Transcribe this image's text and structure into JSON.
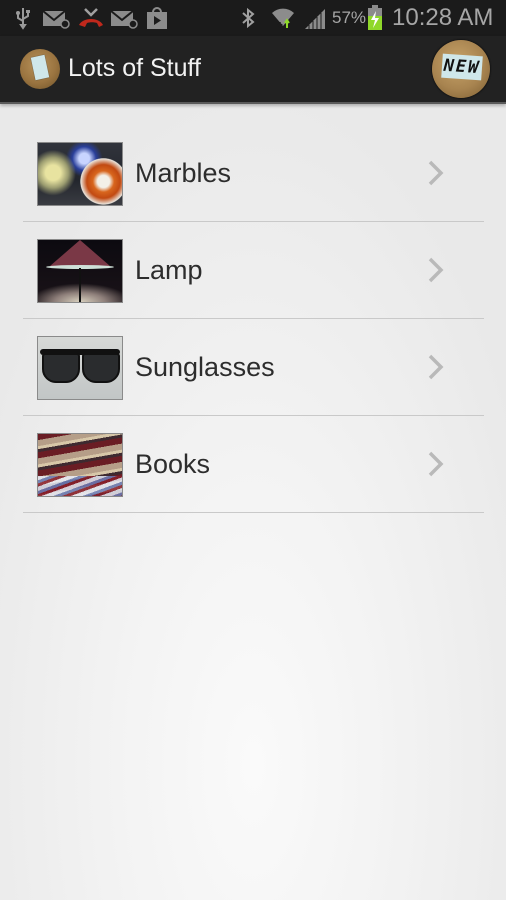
{
  "status_bar": {
    "left_icons": [
      "usb-icon",
      "email-icon",
      "missed-call-icon",
      "email-icon",
      "play-store-icon"
    ],
    "right_icons": [
      "bluetooth-icon",
      "wifi-icon",
      "signal-icon",
      "battery-charging-icon"
    ],
    "battery_percent": "57%",
    "time": "10:28 AM",
    "colors": {
      "missed_call": "#c0281c",
      "battery": "#8fd82a",
      "wifi_arrow": "#8fd82a"
    }
  },
  "action_bar": {
    "app_icon": "notepad-cork-icon",
    "title": "Lots of Stuff",
    "new_button_label": "NEW"
  },
  "list": {
    "items": [
      {
        "label": "Marbles",
        "thumbnail": "marbles-image"
      },
      {
        "label": "Lamp",
        "thumbnail": "lamp-image"
      },
      {
        "label": "Sunglasses",
        "thumbnail": "sunglasses-image"
      },
      {
        "label": "Books",
        "thumbnail": "books-image"
      }
    ],
    "chevron_icon": "chevron-right-icon"
  }
}
